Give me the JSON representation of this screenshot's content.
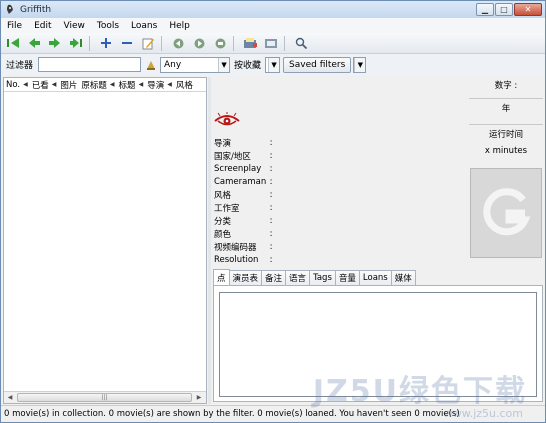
{
  "window": {
    "title": "Griffith",
    "buttons": [
      "minimize",
      "maximize",
      "close"
    ]
  },
  "menu": [
    "File",
    "Edit",
    "View",
    "Tools",
    "Loans",
    "Help"
  ],
  "toolbar": {
    "icons": [
      "first-icon",
      "prev-icon",
      "next-icon",
      "last-icon",
      "add-icon",
      "remove-icon",
      "edit-icon",
      "refresh-icon",
      "sync-icon",
      "export-icon",
      "print-icon",
      "filter-icon",
      "search-icon"
    ]
  },
  "filterbar": {
    "filter_label": "过滤器",
    "filter_value": "",
    "any_option": "Any",
    "sort_label": "按收藏",
    "sort_value": "",
    "saved_filters_label": "Saved filters"
  },
  "list": {
    "columns": [
      "No.",
      "已看",
      "图片",
      "原标题",
      "标题",
      "导演",
      "风格"
    ]
  },
  "details": {
    "fields": [
      "导演",
      "国家/地区",
      "Screenplay",
      "Cameraman",
      "风格",
      "工作室",
      "分类",
      "颜色",
      "视频编码器",
      "Resolution"
    ],
    "right": {
      "number_label": "数字 :",
      "year_label": "年",
      "runtime_label": "运行时间",
      "runtime_value": "x    minutes"
    },
    "tabs": [
      "点",
      "演员表",
      "备注",
      "语言",
      "Tags",
      "音量",
      "Loans",
      "媒体"
    ]
  },
  "status": "0 movie(s) in collection. 0 movie(s) are shown by the filter. 0 movie(s) loaned. You haven't seen 0 movie(s)",
  "watermark": {
    "main": "JZ5U绿色下载",
    "sub": "www.jz5u.com"
  }
}
